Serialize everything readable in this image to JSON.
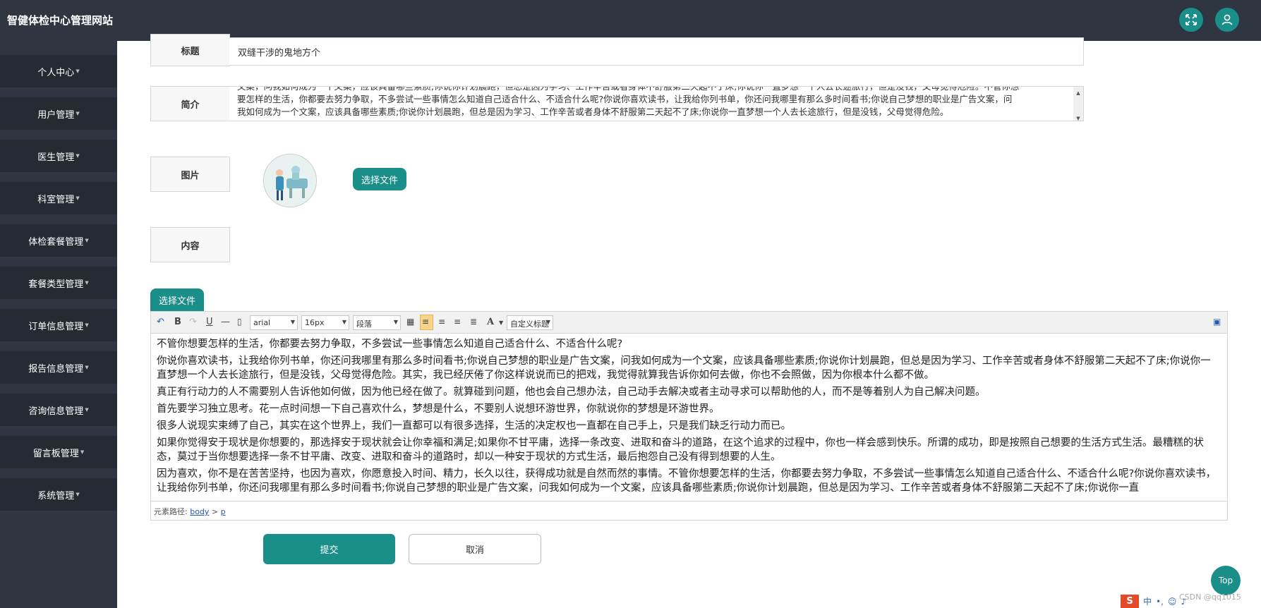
{
  "header": {
    "site_title": "智健体检中心管理网站",
    "icons": [
      "fullscreen-icon",
      "user-icon"
    ]
  },
  "sidebar": {
    "items": [
      {
        "label": "个人中心"
      },
      {
        "label": "用户管理"
      },
      {
        "label": "医生管理"
      },
      {
        "label": "科室管理"
      },
      {
        "label": "体检套餐管理"
      },
      {
        "label": "套餐类型管理"
      },
      {
        "label": "订单信息管理"
      },
      {
        "label": "报告信息管理"
      },
      {
        "label": "咨询信息管理"
      },
      {
        "label": "留言板管理"
      },
      {
        "label": "系统管理"
      }
    ]
  },
  "form": {
    "title_label": "标题",
    "title_value": "双缝干涉的鬼地方个",
    "intro_label": "简介",
    "intro_lines": [
      "文案，问我如何成为一个文案，应该具备哪些素质;你说你计划晨跑，但总是因为学习、工作辛苦或者身体不舒服第二天起不了床;你说你一直梦想一个人去长途旅行，但是没钱，父母觉得危险。不管你想",
      "要怎样的生活，你都要去努力争取，不多尝试一些事情怎么知道自己适合什么、不适合什么呢?你说你喜欢读书，让我给你列书单，你还问我哪里有那么多时间看书;你说自己梦想的职业是广告文案，问",
      "我如何成为一个文案，应该具备哪些素质;你说你计划晨跑，但总是因为学习、工作辛苦或者身体不舒服第二天起不了床;你说你一直梦想一个人去长途旅行，但是没钱，父母觉得危险。"
    ],
    "image_label": "图片",
    "choose_file": "选择文件",
    "content_label": "内容",
    "content_choose_file": "选择文件",
    "submit": "提交",
    "cancel": "取消"
  },
  "editor": {
    "font_family": "arial",
    "font_size": "16px",
    "paragraph": "段落",
    "custom_title": "自定义标题",
    "font_color_glyph": "A",
    "bold_glyph": "B",
    "underline_glyph": "U",
    "status_prefix": "元素路径:",
    "status_body": "body",
    "status_sep": ">",
    "status_p": "p",
    "paragraphs": [
      "不管你想要怎样的生活，你都要去努力争取，不多尝试一些事情怎么知道自己适合什么、不适合什么呢?",
      "你说你喜欢读书，让我给你列书单，你还问我哪里有那么多时间看书;你说自己梦想的职业是广告文案，问我如何成为一个文案，应该具备哪些素质;你说你计划晨跑，但总是因为学习、工作辛苦或者身体不舒服第二天起不了床;你说你一直梦想一个人去长途旅行，但是没钱，父母觉得危险。其实，我已经厌倦了你这样说说而已的把戏，我觉得就算我告诉你如何去做，你也不会照做，因为你根本什么都不做。",
      "真正有行动力的人不需要别人告诉他如何做，因为他已经在做了。就算碰到问题，他也会自己想办法，自己动手去解决或者主动寻求可以帮助他的人，而不是等着别人为自己解决问题。",
      "首先要学习独立思考。花一点时间想一下自己喜欢什么，梦想是什么，不要别人说想环游世界，你就说你的梦想是环游世界。",
      "很多人说现实束缚了自己，其实在这个世界上，我们一直都可以有很多选择，生活的决定权也一直都在自己手上，只是我们缺乏行动力而已。",
      "如果你觉得安于现状是你想要的，那选择安于现状就会让你幸福和满足;如果你不甘平庸，选择一条改变、进取和奋斗的道路，在这个追求的过程中，你也一样会感到快乐。所谓的成功，即是按照自己想要的生活方式生活。最糟糕的状态，莫过于当你想要选择一条不甘平庸、改变、进取和奋斗的道路时，却以一种安于现状的方式生活，最后抱怨自己没有得到想要的人生。",
      "因为喜欢，你不是在苦苦坚持，也因为喜欢，你愿意投入时间、精力，长久以往，获得成功就是自然而然的事情。不管你想要怎样的生活，你都要去努力争取，不多尝试一些事情怎么知道自己适合什么、不适合什么呢?你说你喜欢读书，让我给你列书单，你还问我哪里有那么多时间看书;你说自己梦想的职业是广告文案，问我如何成为一个文案，应该具备哪些素质;你说你计划晨跑，但总是因为学习、工作辛苦或者身体不舒服第二天起不了床;你说你一直"
    ]
  },
  "misc": {
    "top_button": "Top",
    "watermark": "CSDN @qq1015",
    "ime_logo": "S",
    "ime_lang": "中"
  },
  "colors": {
    "teal": "#1a8f8a",
    "sidebar_bg": "#303641",
    "sidebar_item_bg": "#252a33"
  }
}
